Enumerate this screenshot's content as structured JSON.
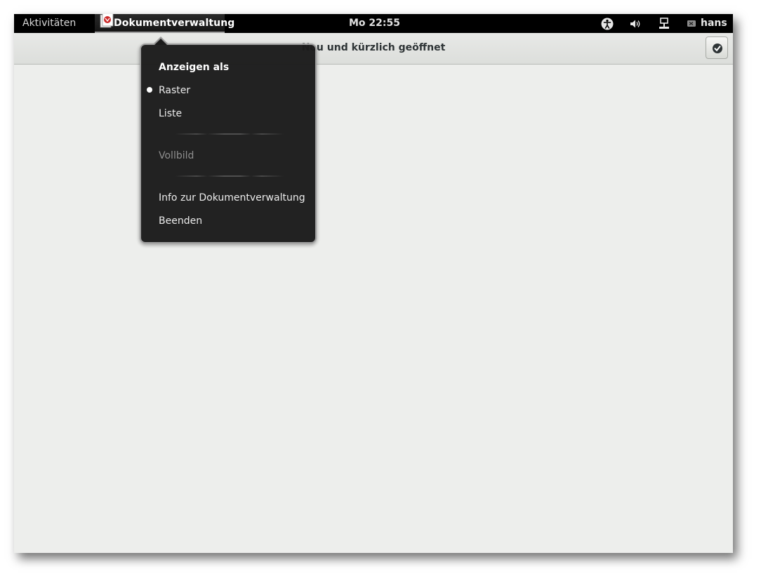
{
  "topbar": {
    "activities": "Aktivitäten",
    "app_name": "Dokumentverwaltung",
    "clock": "Mo 22:55",
    "user": "hans",
    "tray_icons": [
      "accessibility-icon",
      "volume-icon",
      "network-icon",
      "chat-icon"
    ]
  },
  "header": {
    "title": "Neu und kürzlich geöffnet",
    "select_icon": "checkmark-icon"
  },
  "app_menu": {
    "section_title": "Anzeigen als",
    "items": [
      {
        "label": "Raster",
        "selected": true
      },
      {
        "label": "Liste",
        "selected": false
      }
    ],
    "fullscreen": "Vollbild",
    "about": "Info zur Dokumentverwaltung",
    "quit": "Beenden"
  },
  "colors": {
    "topbar_bg": "#000000",
    "content_bg": "#edeeec",
    "popup_bg": "#1c1c1c",
    "popup_border": "#9e9e9e"
  }
}
